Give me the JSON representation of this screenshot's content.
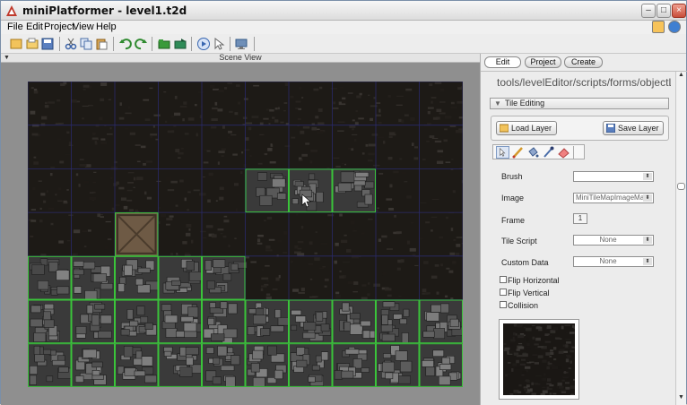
{
  "window": {
    "title": "miniPlatformer - level1.t2d"
  },
  "menu": [
    "File",
    "Edit",
    "Project",
    "View",
    "Help"
  ],
  "toolbar_icons": [
    "new-file-icon",
    "open-folder-icon",
    "save-icon",
    "cut-icon",
    "copy-icon",
    "paste-icon",
    "undo-icon",
    "redo-icon",
    "folder-add-icon",
    "folder-open-icon",
    "play-icon",
    "pointer-icon",
    "monitor-icon"
  ],
  "scene": {
    "label": "Scene View"
  },
  "panel": {
    "tabs": [
      "Edit",
      "Project",
      "Create"
    ],
    "path": "tools/levelEditor/scripts/forms/objectLibr",
    "rollout_title": "Tile Editing",
    "load_layer": "Load Layer",
    "save_layer": "Save Layer",
    "tools": [
      "select-tool-icon",
      "brush-tool-icon",
      "fill-tool-icon",
      "eyedropper-tool-icon",
      "eraser-tool-icon"
    ],
    "fields": {
      "brush": {
        "label": "Brush",
        "value": ""
      },
      "image": {
        "label": "Image",
        "value": "MiniTileMapImageMap"
      },
      "frame": {
        "label": "Frame",
        "value": "1"
      },
      "tile_script": {
        "label": "Tile Script",
        "value": "None"
      },
      "custom_data": {
        "label": "Custom Data",
        "value": "None"
      }
    },
    "checks": {
      "flip_horizontal": "Flip Horizontal",
      "flip_vertical": "Flip Vertical",
      "collision": "Collision"
    }
  },
  "tilemap": {
    "cols": 10,
    "rows": 7,
    "stone_tiles": [
      [
        5,
        2
      ],
      [
        6,
        2
      ],
      [
        7,
        2
      ],
      [
        0,
        4
      ],
      [
        1,
        4
      ],
      [
        2,
        4
      ],
      [
        3,
        4
      ],
      [
        4,
        4
      ],
      [
        0,
        5
      ],
      [
        1,
        5
      ],
      [
        2,
        5
      ],
      [
        3,
        5
      ],
      [
        4,
        5
      ],
      [
        5,
        5
      ],
      [
        6,
        5
      ],
      [
        7,
        5
      ],
      [
        8,
        5
      ],
      [
        9,
        5
      ],
      [
        0,
        6
      ],
      [
        1,
        6
      ],
      [
        2,
        6
      ],
      [
        3,
        6
      ],
      [
        4,
        6
      ],
      [
        5,
        6
      ],
      [
        6,
        6
      ],
      [
        7,
        6
      ],
      [
        8,
        6
      ],
      [
        9,
        6
      ]
    ],
    "crate_tiles": [
      [
        2,
        3
      ]
    ]
  }
}
